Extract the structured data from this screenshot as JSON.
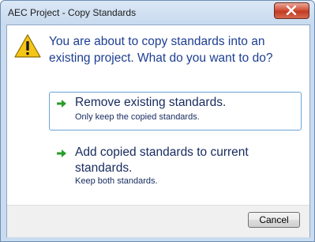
{
  "window": {
    "title": "AEC Project - Copy Standards"
  },
  "dialog": {
    "instruction": "You are about to copy standards into an existing project. What do you want to do?",
    "options": [
      {
        "title": "Remove existing standards.",
        "note": "Only keep the copied standards."
      },
      {
        "title": "Add copied standards to current standards.",
        "note": "Keep both standards."
      }
    ],
    "cancel_label": "Cancel"
  },
  "icons": {
    "close": "close-icon",
    "warning": "warning-icon",
    "option_arrow": "green-arrow-icon"
  },
  "colors": {
    "instruction_text": "#1d3e92",
    "arrow_green": "#2a9d2a",
    "close_red": "#c13b22"
  }
}
